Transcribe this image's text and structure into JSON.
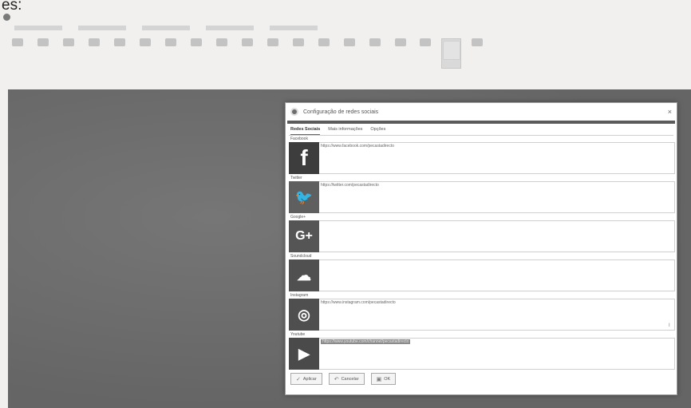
{
  "caption": "es:",
  "app_title": "",
  "ribbon": {
    "tabs": [
      "",
      "",
      "",
      "",
      ""
    ],
    "buttons": [
      "",
      "",
      "",
      "",
      "",
      "",
      "",
      "",
      "",
      "",
      "",
      "",
      "",
      "",
      "",
      "",
      "",
      "",
      ""
    ],
    "active_index": 17,
    "group_label": ""
  },
  "dialog": {
    "title": "Configuração de redes sociais",
    "close": "×",
    "tabs": [
      "Redes Sociais",
      "Mais informações",
      "Opções"
    ],
    "selected_tab": "Redes Sociais",
    "networks": [
      {
        "name": "Facebook",
        "glyph": "f",
        "color": "#3d3d3d",
        "url": "https://www.facebook.com/pecastadirecto"
      },
      {
        "name": "Twitter",
        "glyph": "🐦",
        "color": "#5f5f5f",
        "url": "https://twitter.com/pecastadirecto"
      },
      {
        "name": "Google+",
        "glyph": "G+",
        "color": "#555555",
        "url": ""
      },
      {
        "name": "Soundcloud",
        "glyph": "☁",
        "color": "#505050",
        "url": ""
      },
      {
        "name": "Instagram",
        "glyph": "◎",
        "color": "#4f4f4f",
        "url": "https://www.instagram.com/pecastadirecto"
      },
      {
        "name": "Youtube",
        "glyph": "▶",
        "color": "#4a4a4a",
        "url": "https://www.youtube.com/channel/pecastadirecto",
        "selected": true
      }
    ],
    "footer": {
      "apply": "Aplicar",
      "cancel": "Cancelar",
      "ok": "OK"
    }
  },
  "colors": {
    "workspace": "#6b6b6b",
    "dialog_bar": "#5b5b5b"
  }
}
